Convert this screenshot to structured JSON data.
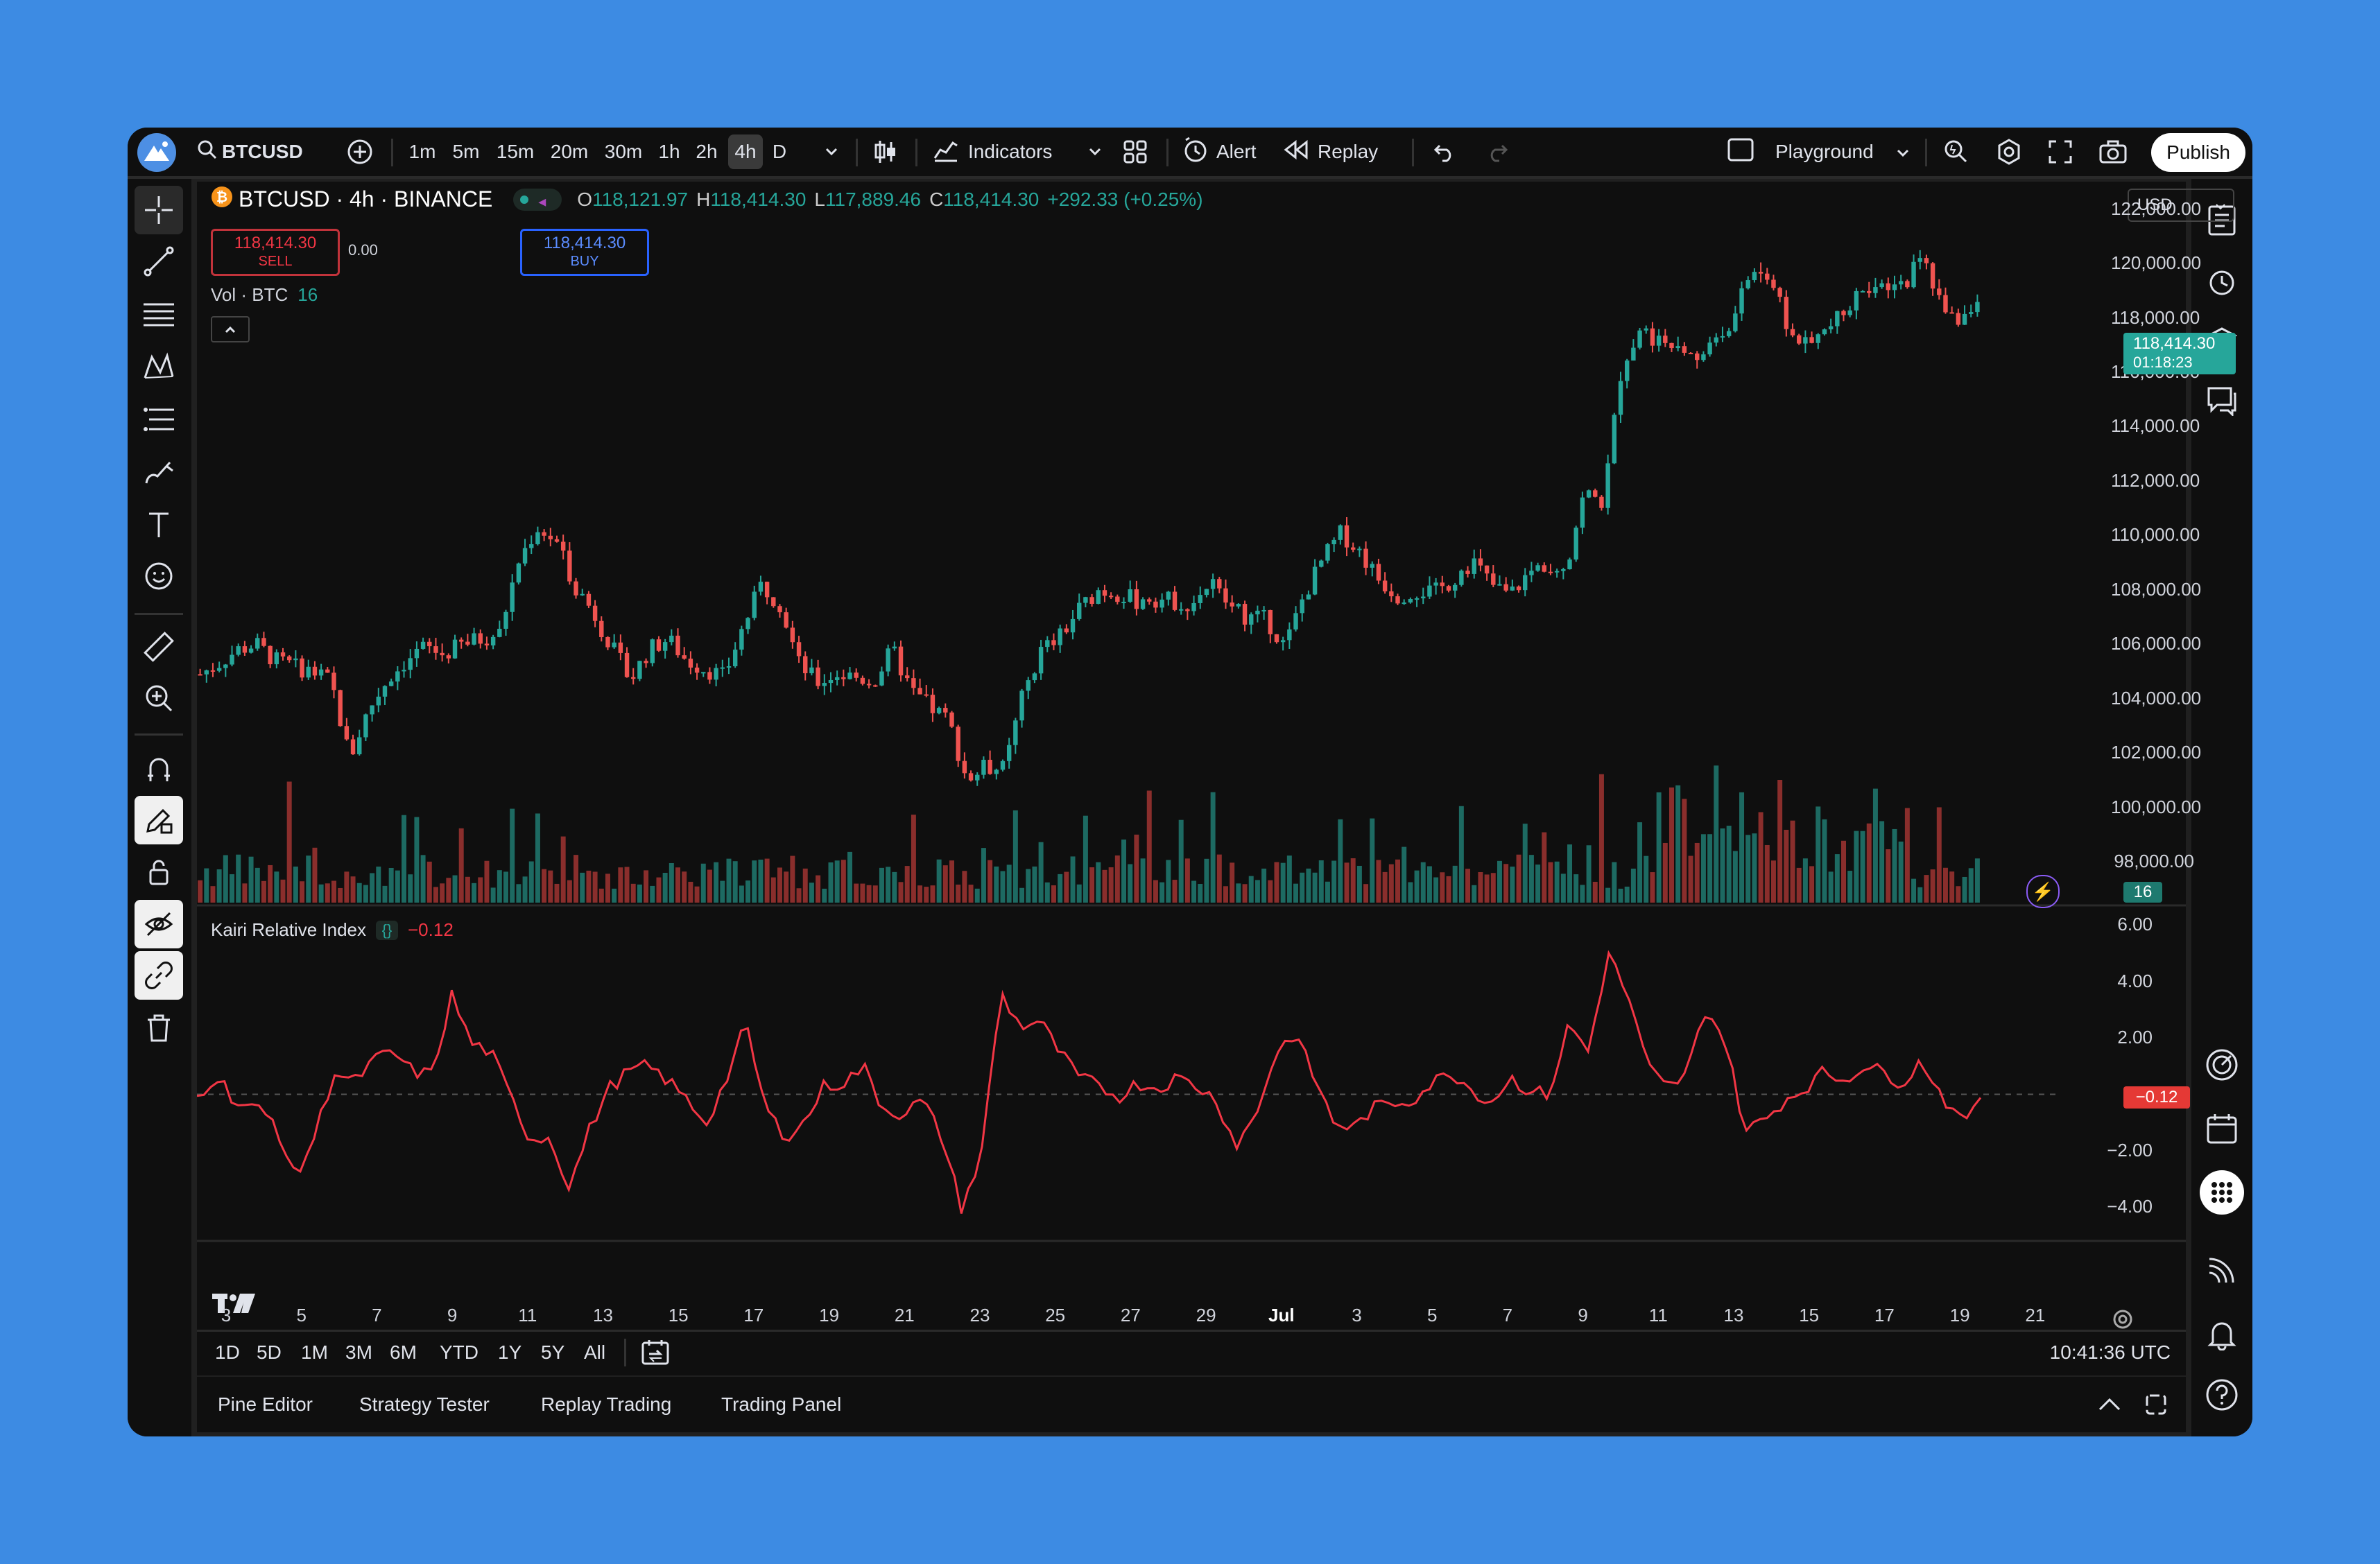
{
  "toolbar": {
    "symbol": "BTCUSD",
    "timeframes": [
      "1m",
      "5m",
      "15m",
      "20m",
      "30m",
      "1h",
      "2h",
      "4h",
      "D"
    ],
    "active_timeframe": "4h",
    "indicators_label": "Indicators",
    "alert_label": "Alert",
    "replay_label": "Replay",
    "layout_name": "Playground",
    "publish_label": "Publish"
  },
  "legend": {
    "title": "BTCUSD · 4h · BINANCE",
    "open_label": "O",
    "open": "118,121.97",
    "high_label": "H",
    "high": "118,414.30",
    "low_label": "L",
    "low": "117,889.46",
    "close_label": "C",
    "close": "118,414.30",
    "change": "+292.33 (+0.25%)",
    "sell_price": "118,414.30",
    "sell_label": "SELL",
    "spread": "0.00",
    "buy_price": "118,414.30",
    "buy_label": "BUY",
    "volume_label": "Vol · BTC",
    "volume_value": "16"
  },
  "currency": "USD",
  "price_axis": [
    "122,000.00",
    "120,000.00",
    "118,000.00",
    "116,000.00",
    "114,000.00",
    "112,000.00",
    "110,000.00",
    "108,000.00",
    "106,000.00",
    "104,000.00",
    "102,000.00",
    "100,000.00",
    "98,000.00"
  ],
  "last_price_tag": "118,414.30",
  "countdown": "01:18:23",
  "volume_tag": "16",
  "indicator": {
    "name": "Kairi Relative Index",
    "value": "−0.12",
    "axis": [
      "6.00",
      "4.00",
      "2.00",
      "−2.00",
      "−4.00"
    ],
    "tag": "−0.12"
  },
  "time_axis": [
    "3",
    "5",
    "7",
    "9",
    "11",
    "13",
    "15",
    "17",
    "19",
    "21",
    "23",
    "25",
    "27",
    "29",
    "Jul",
    "3",
    "5",
    "7",
    "9",
    "11",
    "13",
    "15",
    "17",
    "19",
    "21"
  ],
  "ranges": [
    "1D",
    "5D",
    "1M",
    "3M",
    "6M",
    "YTD",
    "1Y",
    "5Y",
    "All"
  ],
  "clock": "10:41:36 UTC",
  "bottom_tabs": [
    "Pine Editor",
    "Strategy Tester",
    "Replay Trading",
    "Trading Panel"
  ],
  "colors": {
    "up": "#26a69a",
    "down": "#ef5350",
    "indicator": "#f23645",
    "background": "#0f0f0f"
  },
  "chart_data": {
    "type": "candlestick",
    "price_series_close": [
      104900,
      105300,
      105800,
      106000,
      105400,
      105200,
      105000,
      104600,
      101800,
      103600,
      104700,
      105400,
      105900,
      105600,
      106000,
      106200,
      106400,
      109000,
      110300,
      109800,
      108200,
      107200,
      105900,
      104700,
      105800,
      106200,
      105400,
      105100,
      104800,
      106600,
      108200,
      107500,
      105300,
      104600,
      104900,
      104800,
      104600,
      105800,
      104300,
      103700,
      103200,
      101000,
      101500,
      101400,
      104200,
      105800,
      106300,
      107300,
      108000,
      107900,
      107600,
      107700,
      107600,
      107500,
      108300,
      107400,
      107000,
      106900,
      105900,
      107800,
      109100,
      110100,
      109400,
      108400,
      107800,
      108000,
      107900,
      108400,
      109100,
      108200,
      107800,
      108600,
      109000,
      108900,
      111600,
      111200,
      116300,
      117600,
      117100,
      117300,
      116600,
      117300,
      118000,
      120000,
      119400,
      117400,
      116900,
      117600,
      118200,
      119300,
      118900,
      119200,
      120300,
      118600,
      117900,
      118400
    ],
    "indicator_values": [
      -0.1,
      0.7,
      -0.3,
      -0.5,
      -1.0,
      -3.0,
      -1.5,
      0.8,
      0.4,
      1.2,
      1.5,
      0.8,
      0.7,
      3.5,
      1.8,
      1.5,
      -0.1,
      -1.6,
      -1.5,
      -3.3,
      -1.3,
      0.2,
      0.8,
      1.0,
      0.5,
      -0.2,
      -1.0,
      0.5,
      2.5,
      -0.5,
      -1.5,
      -1.0,
      0.3,
      0.4,
      1.0,
      -0.5,
      -0.7,
      -0.2,
      -1.5,
      -4.0,
      -2.3,
      3.6,
      2.4,
      2.6,
      1.5,
      0.6,
      0.3,
      -0.1,
      0.4,
      0.2,
      0.6,
      0.3,
      -0.2,
      -1.8,
      -0.8,
      1.4,
      2.2,
      0.6,
      -1.0,
      -1.2,
      -0.5,
      -0.3,
      -0.2,
      0.4,
      0.8,
      0.2,
      -0.3,
      0.6,
      0.1,
      0.0,
      2.5,
      1.5,
      5.0,
      3.5,
      1.0,
      0.2,
      0.7,
      3.1,
      1.8,
      -1.3,
      -0.9,
      -0.2,
      0.2,
      0.8,
      0.5,
      1.0,
      0.8,
      0.4,
      1.2,
      0.0,
      -1.0,
      -0.12
    ],
    "price_range": [
      96500,
      122500
    ],
    "indicator_range": [
      -5,
      6.5
    ]
  }
}
